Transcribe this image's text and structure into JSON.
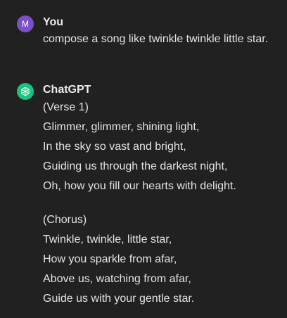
{
  "colors": {
    "background": "#212121",
    "text": "#ececec",
    "user_avatar": "#7a52c6",
    "assistant_avatar": "#19c37d"
  },
  "messages": {
    "user": {
      "avatar_letter": "M",
      "author": "You",
      "text": "compose a song like twinkle twinkle little star."
    },
    "assistant": {
      "avatar_icon": "openai-logo-icon",
      "author": "ChatGPT",
      "stanzas": [
        {
          "lines": [
            "(Verse 1)",
            "Glimmer, glimmer, shining light,",
            "In the sky so vast and bright,",
            "Guiding us through the darkest night,",
            "Oh, how you fill our hearts with delight."
          ]
        },
        {
          "lines": [
            "(Chorus)",
            "Twinkle, twinkle, little star,",
            "How you sparkle from afar,",
            "Above us, watching from afar,",
            "Guide us with your gentle star."
          ]
        }
      ]
    }
  }
}
